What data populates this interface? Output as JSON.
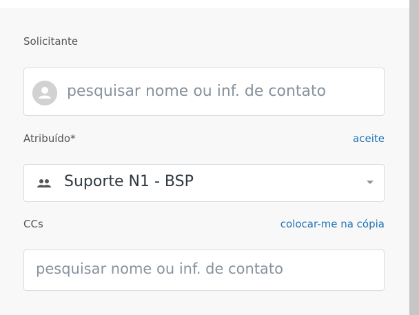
{
  "requester": {
    "label": "Solicitante",
    "placeholder": "pesquisar nome ou inf. de contato",
    "avatar_icon": "user-avatar-icon"
  },
  "assignee": {
    "label": "Atribuído*",
    "take_it_link": "aceite",
    "value": "Suporte N1 - BSP",
    "group_icon": "group-icon",
    "dropdown_icon": "chevron-down-icon"
  },
  "ccs": {
    "label": "CCs",
    "cc_me_link": "colocar-me na cópia",
    "placeholder": "pesquisar nome ou inf. de contato"
  },
  "colors": {
    "link": "#1f73b7",
    "label": "#555555",
    "placeholder": "#87929d",
    "panel_background": "#f8f8f8",
    "scrollbar": "#c6c6c6"
  }
}
